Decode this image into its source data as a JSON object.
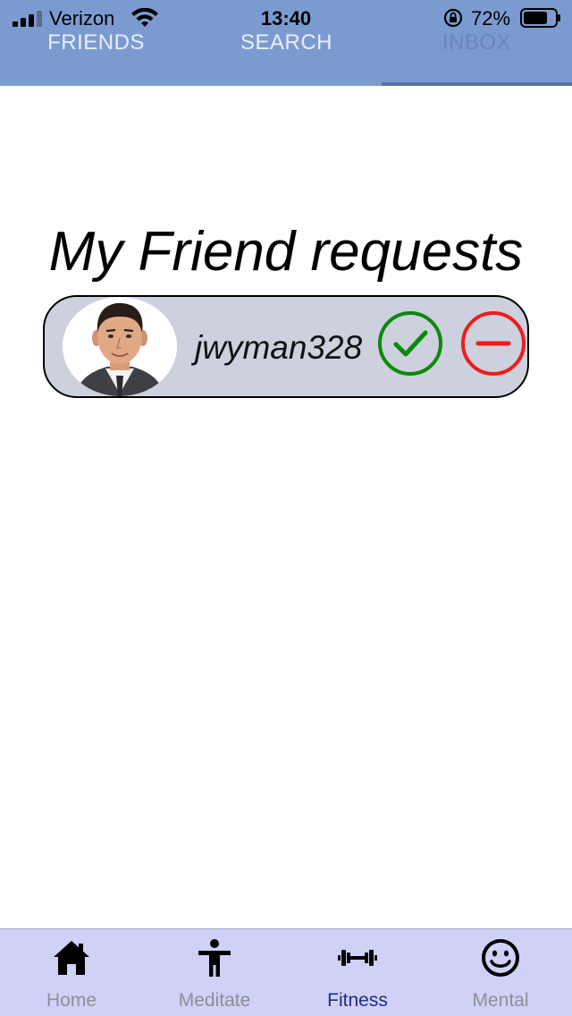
{
  "status_bar": {
    "carrier": "Verizon",
    "time": "13:40",
    "battery": "72%"
  },
  "top_tabs": [
    {
      "label": "FRIENDS",
      "selected": false
    },
    {
      "label": "SEARCH",
      "selected": false
    },
    {
      "label": "INBOX",
      "selected": true
    }
  ],
  "main": {
    "title": "My Friend requests",
    "requests": [
      {
        "username": "jwyman328",
        "avatar": "man-portrait-avatar"
      }
    ]
  },
  "bottom_tabs": [
    {
      "label": "Home",
      "icon": "home-icon",
      "selected": false
    },
    {
      "label": "Meditate",
      "icon": "person-stretch-icon",
      "selected": false
    },
    {
      "label": "Fitness",
      "icon": "dumbbell-icon",
      "selected": true
    },
    {
      "label": "Mental",
      "icon": "smiley-icon",
      "selected": false
    }
  ],
  "colors": {
    "header_bg": "#7b9bd0",
    "tab_indicator": "#5a6fa6",
    "card_bg": "#cdd0dd",
    "accept": "#0a8a0a",
    "decline": "#ee1c1c",
    "tabbar_bg": "#d0d1f7",
    "tabbar_active": "#1a2d8a"
  }
}
